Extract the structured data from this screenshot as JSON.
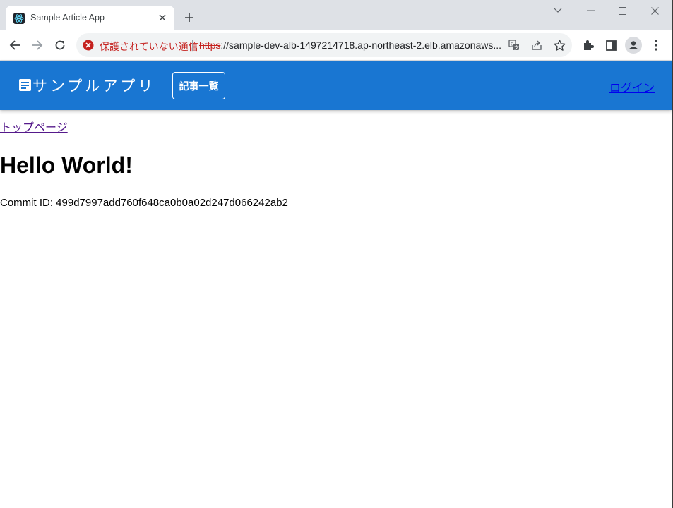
{
  "browser": {
    "tab": {
      "title": "Sample Article App",
      "favicon": "react-logo-icon"
    },
    "new_tab_icon": "plus-icon",
    "window_controls": [
      "chevron-down-icon",
      "minimize-icon",
      "maximize-icon",
      "close-icon"
    ],
    "toolbar": {
      "back_icon": "back-arrow-icon",
      "forward_icon": "forward-arrow-icon",
      "reload_icon": "reload-icon",
      "security_text": "保護されていない通信",
      "url_scheme": "https",
      "url_rest": "://sample-dev-alb-1497214718.ap-northeast-2.elb.amazonaws...",
      "omnibox_icons": [
        "translate-icon",
        "share-icon",
        "bookmark-star-icon"
      ],
      "right_icons": [
        "extensions-icon",
        "side-panel-icon",
        "profile-avatar-icon",
        "more-menu-icon"
      ]
    },
    "colors": {
      "security_red": "#c5221f",
      "tabstrip": "#dee1e6"
    }
  },
  "app": {
    "brand_icon": "article-icon",
    "brand_name": "サンプルアプリ",
    "articles_button": "記事一覧",
    "login_link": "ログイン",
    "colors": {
      "appbar": "#1976d2"
    }
  },
  "content": {
    "top_link": "トップページ",
    "heading": "Hello World!",
    "commit_text": "Commit ID: 499d7997add760f648ca0b0a02d247d066242ab2"
  }
}
